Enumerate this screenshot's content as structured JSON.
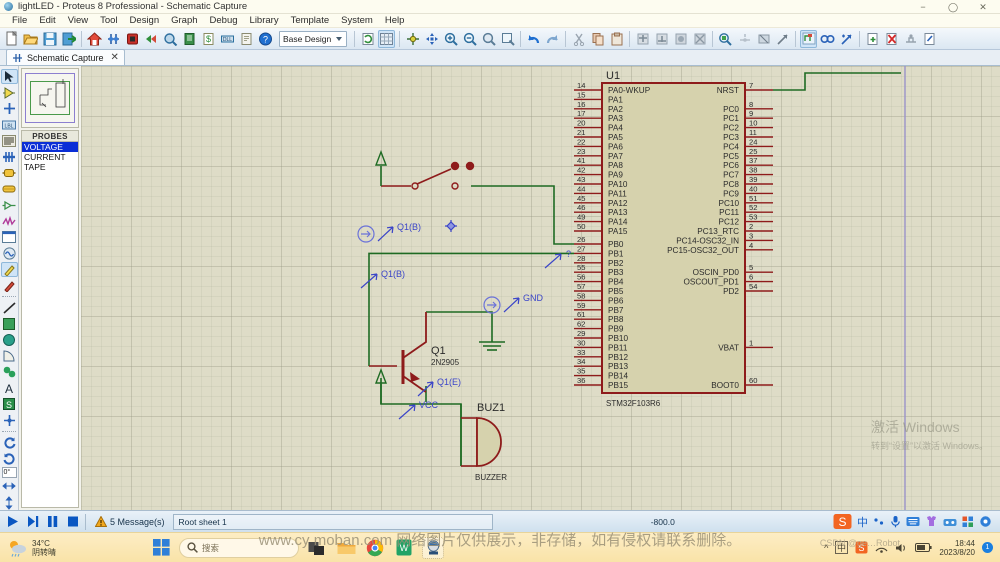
{
  "window": {
    "title": "lightLED - Proteus 8 Professional - Schematic Capture",
    "app_icon": "proteus-icon",
    "minimize": "–",
    "maximize": "⬜",
    "close": "✕"
  },
  "menubar": {
    "items": [
      {
        "label": "File"
      },
      {
        "label": "Edit"
      },
      {
        "label": "View"
      },
      {
        "label": "Tool"
      },
      {
        "label": "Design"
      },
      {
        "label": "Graph"
      },
      {
        "label": "Debug"
      },
      {
        "label": "Library"
      },
      {
        "label": "Template"
      },
      {
        "label": "System"
      },
      {
        "label": "Help"
      }
    ]
  },
  "toolbar": {
    "design_selector": {
      "value": "Base Design",
      "chevron": "chevron-down-icon"
    },
    "groups": [
      [
        "new-file",
        "open-file",
        "save-file",
        "import-export"
      ],
      [
        "home-page",
        "schematic-capture",
        "pcb-layout",
        "3d-visualizer",
        "design-explorer",
        "bill-of-materials",
        "bill-cost",
        "proteus-vsm",
        "project-notes",
        "help"
      ],
      [
        "refresh",
        "toggle-grid"
      ],
      [
        "origin",
        "pan",
        "zoom-in",
        "zoom-out",
        "zoom-area",
        "zoom-sheet"
      ],
      [
        "undo",
        "redo"
      ],
      [
        "cut",
        "copy",
        "paste"
      ],
      [
        "block-copy",
        "block-move",
        "block-rotate",
        "block-delete"
      ],
      [
        "pick-device",
        "make-device",
        "packaging-tool",
        "decompose"
      ],
      [
        "wire-autorouter",
        "search-tag",
        "property-assignment"
      ],
      [
        "new-sheet",
        "remove-sheet",
        "exit-sheet",
        "design-explorer-2"
      ]
    ]
  },
  "tabs": [
    {
      "label": "Schematic Capture",
      "icon": "schematic-icon",
      "close": "✕",
      "active": true
    }
  ],
  "left_rail": {
    "tools": [
      "selection-mode-icon",
      "component-mode-icon",
      "junction-dot-icon",
      "wire-label-icon",
      "text-script-icon",
      "buses-icon",
      "subcircuit-icon",
      "terminals-mode-icon",
      "device-pins-icon",
      "graph-mode-icon",
      "tape-recorder-icon",
      "generator-mode-icon",
      "voltage-probe-icon",
      "current-probe-icon",
      "2d-line-icon",
      "2d-box-icon",
      "2d-circle-icon",
      "2d-arc-icon",
      "2d-path-icon",
      "2d-text-icon",
      "2d-symbol-icon",
      "2d-marker-icon"
    ],
    "rotation": {
      "label": "0°",
      "rotate-cw": "rotate-cw-icon",
      "rotate-ccw": "rotate-ccw-icon"
    },
    "mirror": {
      "mirror-x": "mirror-horizontal-icon",
      "mirror-y": "mirror-vertical-icon"
    }
  },
  "panels": {
    "overview": {
      "name": "overview-preview"
    },
    "probes": {
      "header": "PROBES",
      "items": [
        {
          "label": "VOLTAGE",
          "selected": true
        },
        {
          "label": "CURRENT",
          "selected": false
        },
        {
          "label": "TAPE",
          "selected": false
        }
      ]
    }
  },
  "schematic": {
    "ic": {
      "reference": "U1",
      "part_number": "STM32F103R6",
      "left_pins": [
        {
          "num": "14",
          "name": "PA0-WKUP"
        },
        {
          "num": "15",
          "name": "PA1"
        },
        {
          "num": "16",
          "name": "PA2"
        },
        {
          "num": "17",
          "name": "PA3"
        },
        {
          "num": "20",
          "name": "PA4"
        },
        {
          "num": "21",
          "name": "PA5"
        },
        {
          "num": "22",
          "name": "PA6"
        },
        {
          "num": "23",
          "name": "PA7"
        },
        {
          "num": "41",
          "name": "PA8"
        },
        {
          "num": "42",
          "name": "PA9"
        },
        {
          "num": "43",
          "name": "PA10"
        },
        {
          "num": "44",
          "name": "PA11"
        },
        {
          "num": "45",
          "name": "PA12"
        },
        {
          "num": "46",
          "name": "PA13"
        },
        {
          "num": "49",
          "name": "PA14"
        },
        {
          "num": "50",
          "name": "PA15"
        },
        {
          "num": "26",
          "name": "PB0"
        },
        {
          "num": "27",
          "name": "PB1"
        },
        {
          "num": "28",
          "name": "PB2"
        },
        {
          "num": "55",
          "name": "PB3"
        },
        {
          "num": "56",
          "name": "PB4"
        },
        {
          "num": "57",
          "name": "PB5"
        },
        {
          "num": "58",
          "name": "PB6"
        },
        {
          "num": "59",
          "name": "PB7"
        },
        {
          "num": "61",
          "name": "PB8"
        },
        {
          "num": "62",
          "name": "PB9"
        },
        {
          "num": "29",
          "name": "PB10"
        },
        {
          "num": "30",
          "name": "PB11"
        },
        {
          "num": "33",
          "name": "PB12"
        },
        {
          "num": "34",
          "name": "PB13"
        },
        {
          "num": "35",
          "name": "PB14"
        },
        {
          "num": "36",
          "name": "PB15"
        }
      ],
      "right_pins": [
        {
          "num": "7",
          "name": "NRST"
        },
        {
          "num": "8",
          "name": "PC0"
        },
        {
          "num": "9",
          "name": "PC1"
        },
        {
          "num": "10",
          "name": "PC2"
        },
        {
          "num": "11",
          "name": "PC3"
        },
        {
          "num": "24",
          "name": "PC4"
        },
        {
          "num": "25",
          "name": "PC5"
        },
        {
          "num": "37",
          "name": "PC6"
        },
        {
          "num": "38",
          "name": "PC7"
        },
        {
          "num": "39",
          "name": "PC8"
        },
        {
          "num": "40",
          "name": "PC9"
        },
        {
          "num": "51",
          "name": "PC10"
        },
        {
          "num": "52",
          "name": "PC11"
        },
        {
          "num": "53",
          "name": "PC12"
        },
        {
          "num": "2",
          "name": "PC13_RTC"
        },
        {
          "num": "3",
          "name": "PC14-OSC32_IN"
        },
        {
          "num": "4",
          "name": "PC15-OSC32_OUT"
        },
        {
          "num": "5",
          "name": "OSCIN_PD0"
        },
        {
          "num": "6",
          "name": "OSCOUT_PD1"
        },
        {
          "num": "54",
          "name": "PD2"
        },
        {
          "num": "1",
          "name": "VBAT"
        },
        {
          "num": "60",
          "name": "BOOT0"
        }
      ]
    },
    "components": [
      {
        "name": "transistor",
        "reference": "Q1",
        "value": "2N2905"
      },
      {
        "name": "buzzer",
        "reference": "BUZ1",
        "value": "BUZZER"
      },
      {
        "name": "switch",
        "reference": "",
        "value": ""
      }
    ],
    "net_labels": [
      {
        "text": "Q1(B)"
      },
      {
        "text": "Q1(B)"
      },
      {
        "text": "GND"
      },
      {
        "text": "Q1(E)"
      },
      {
        "text": "VCC"
      },
      {
        "text": "?"
      }
    ],
    "colors": {
      "wire_green": "#1e6b23",
      "component_red": "#8e1b1b",
      "label_blue": "#3b45c8",
      "body_fill": "#d6d2ad",
      "canvas": "#dedcc7"
    }
  },
  "statusbar": {
    "play": "play-icon",
    "step": "step-icon",
    "pause": "pause-icon",
    "stop": "stop-icon",
    "warning_icon": "warning-icon",
    "messages": "5 Message(s)",
    "sheet": "Root sheet 1",
    "coordinates": "-800.0",
    "ime": {
      "logo": "sogou-logo",
      "mode": "中",
      "items": [
        "punctuation-icon",
        "voice-input-icon",
        "keyboard-icon",
        "skin-icon",
        "toolbox-icon",
        "apps-icon",
        "settings-icon"
      ]
    }
  },
  "taskbar": {
    "weather": {
      "temp": "34°C",
      "desc": "阴转晴"
    },
    "start": "windows-start-icon",
    "search": {
      "placeholder": "搜索",
      "icon": "search-icon"
    },
    "apps": [
      {
        "name": "task-view-icon"
      },
      {
        "name": "file-explorer-icon"
      },
      {
        "name": "chrome-icon"
      },
      {
        "name": "wps-icon"
      },
      {
        "name": "proteus-icon",
        "active": true
      }
    ],
    "tray": {
      "chevron": "^",
      "items": [
        "input-method-icon",
        "sogou-tray-icon",
        "network-icon",
        "volume-icon",
        "battery-icon"
      ],
      "time": "18:44",
      "date": "2023/8/20",
      "badge": "1"
    }
  },
  "watermarks": {
    "activate_windows_title": "激活 Windows",
    "activate_windows_sub": "转到“设置”以激活 Windows。",
    "site_notice": "www.cy moban.com 网络图片仅供展示，非存储，如有侵权请联系删除。",
    "csdn": "CSDN @ge…Robot"
  }
}
